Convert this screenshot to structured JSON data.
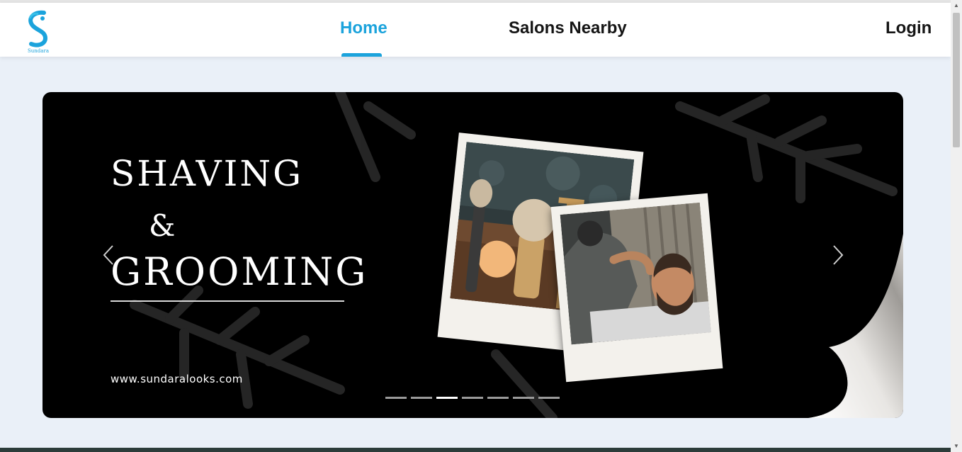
{
  "navbar": {
    "logo": {
      "alt": "Sundara Looks logo",
      "text": "Sundara",
      "icon": "sundara-s-logo-icon"
    },
    "links": [
      {
        "label": "Home",
        "active": true
      },
      {
        "label": "Salons Nearby",
        "active": false
      }
    ],
    "login_label": "Login",
    "accent_color": "#1ba3dc"
  },
  "banner": {
    "title_line1": "SHAVING",
    "title_line2": "&",
    "title_line3": "GROOMING",
    "website": "www.sundaralooks.com",
    "prev_icon": "chevron-left-icon",
    "next_icon": "chevron-right-icon",
    "slide_count": 7,
    "active_slide_index": 2
  }
}
